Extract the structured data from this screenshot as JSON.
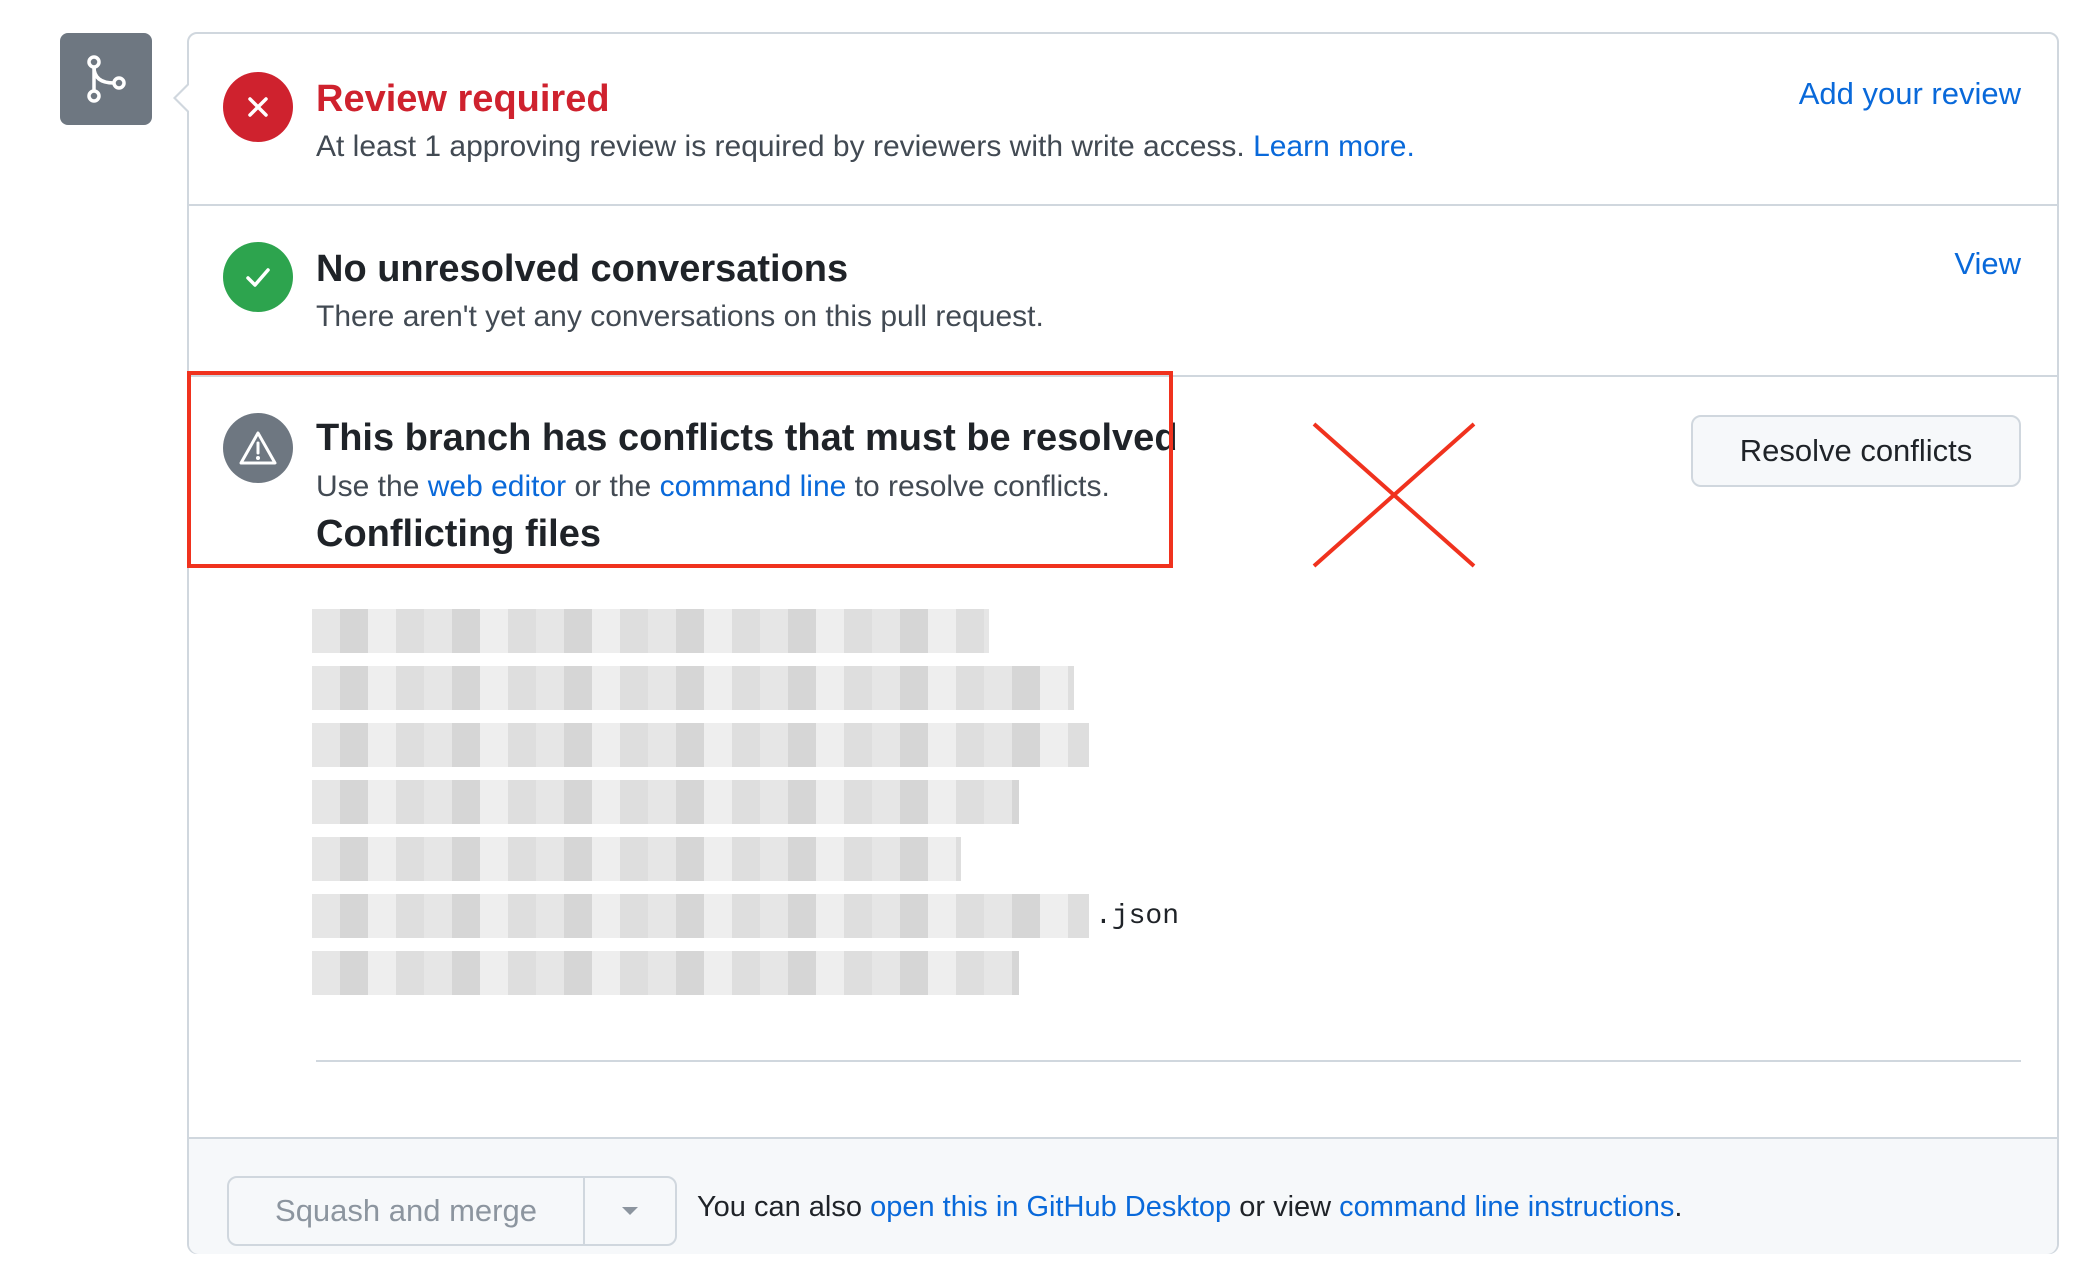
{
  "merge_box": {
    "review": {
      "title": "Review required",
      "description": "At least 1 approving review is required by reviewers with write access.",
      "learn_more": "Learn more.",
      "action": "Add your review",
      "icon": "x-icon",
      "color": "#cf222e"
    },
    "conversations": {
      "title": "No unresolved conversations",
      "description": "There aren't yet any conversations on this pull request.",
      "action": "View",
      "icon": "check-icon",
      "color": "#2da44e"
    },
    "conflicts": {
      "title": "This branch has conflicts that must be resolved",
      "desc_prefix": "Use the",
      "web_editor": "web editor",
      "desc_middle": "or the",
      "command_line": "command line",
      "desc_suffix": "to resolve conflicts.",
      "files_heading": "Conflicting files",
      "resolve_button": "Resolve conflicts",
      "icon": "alert-icon",
      "color": "#6e7781",
      "files": [
        {
          "name": "",
          "redacted": true
        },
        {
          "name": "",
          "redacted": true
        },
        {
          "name": "",
          "redacted": true
        },
        {
          "name": "",
          "redacted": true
        },
        {
          "name": "",
          "redacted": true
        },
        {
          "name": ".json",
          "redacted": true
        },
        {
          "name": "",
          "redacted": true
        }
      ]
    },
    "footer": {
      "merge_button": "Squash and merge",
      "text_prefix": "You can also",
      "desktop_link": "open this in GitHub Desktop",
      "text_middle": "or view",
      "cli_link": "command line instructions",
      "text_suffix": "."
    }
  },
  "annotations": {
    "highlight_color": "#f0321e"
  },
  "colors": {
    "link": "#0969da",
    "border": "#d0d7de",
    "footer_bg": "#f6f8fa",
    "merge_icon_bg": "#6e7781"
  }
}
